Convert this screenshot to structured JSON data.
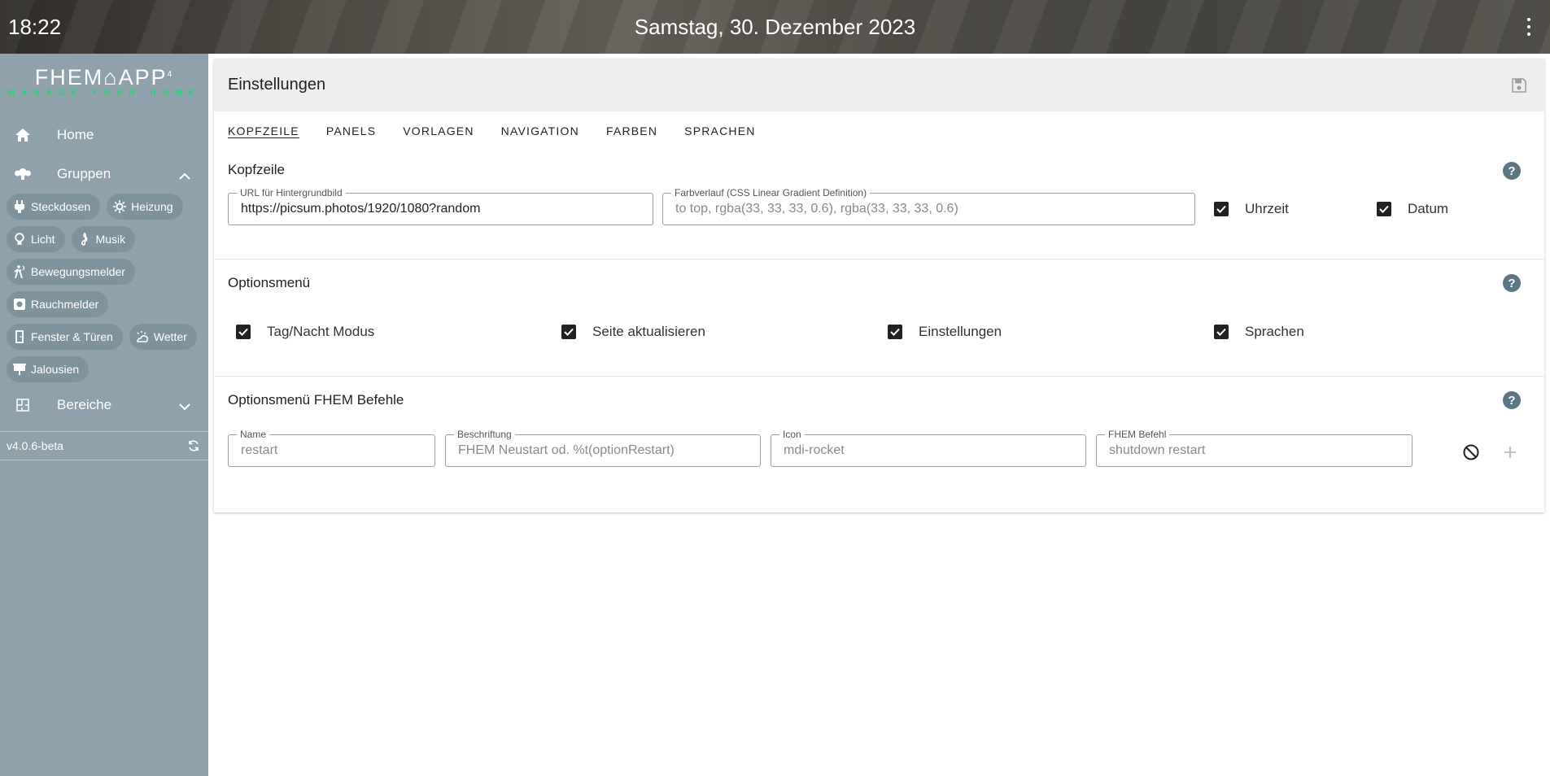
{
  "header": {
    "time": "18:22",
    "date": "Samstag, 30. Dezember 2023",
    "menu_icon": "dots-vertical-icon"
  },
  "sidebar": {
    "logo_main": "FHEM⌂APP",
    "logo_sup": "4",
    "logo_sub": "MANAGE YOUR HOME",
    "home": {
      "label": "Home",
      "icon": "home-icon"
    },
    "groups": {
      "label": "Gruppen",
      "icon": "lightbulb-group-icon",
      "expanded": true
    },
    "chips": [
      {
        "label": "Steckdosen",
        "icon": "power-plug-icon"
      },
      {
        "label": "Heizung",
        "icon": "radiator-icon"
      },
      {
        "label": "Licht",
        "icon": "lightbulb-icon"
      },
      {
        "label": "Musik",
        "icon": "music-clef-icon"
      },
      {
        "label": "Bewegungsmelder",
        "icon": "motion-sensor-icon"
      },
      {
        "label": "Rauchmelder",
        "icon": "smoke-detector-icon"
      },
      {
        "label": "Fenster & Türen",
        "icon": "door-icon"
      },
      {
        "label": "Wetter",
        "icon": "weather-icon"
      },
      {
        "label": "Jalousien",
        "icon": "blinds-icon"
      }
    ],
    "areas": {
      "label": "Bereiche",
      "icon": "floor-plan-icon",
      "expanded": false
    },
    "version": "v4.0.6-beta"
  },
  "settings": {
    "title": "Einstellungen",
    "tabs": [
      "KOPFZEILE",
      "PANELS",
      "VORLAGEN",
      "NAVIGATION",
      "FARBEN",
      "SPRACHEN"
    ],
    "active_tab": "KOPFZEILE",
    "kopfzeile": {
      "title": "Kopfzeile",
      "url_label": "URL für Hintergrundbild",
      "url_value": "https://picsum.photos/1920/1080?random",
      "gradient_label": "Farbverlauf (CSS Linear Gradient Definition)",
      "gradient_placeholder": "to top, rgba(33, 33, 33, 0.6), rgba(33, 33, 33, 0.6)",
      "time_label": "Uhrzeit",
      "time_checked": true,
      "date_label": "Datum",
      "date_checked": true
    },
    "optionsmenu": {
      "title": "Optionsmenü",
      "items": [
        {
          "label": "Tag/Nacht Modus",
          "checked": true
        },
        {
          "label": "Seite aktualisieren",
          "checked": true
        },
        {
          "label": "Einstellungen",
          "checked": true
        },
        {
          "label": "Sprachen",
          "checked": true
        }
      ]
    },
    "fhem_commands": {
      "title": "Optionsmenü FHEM Befehle",
      "name_label": "Name",
      "name_placeholder": "restart",
      "caption_label": "Beschriftung",
      "caption_placeholder": "FHEM Neustart od. %t(optionRestart)",
      "icon_label": "Icon",
      "icon_placeholder": "mdi-rocket",
      "cmd_label": "FHEM Befehl",
      "cmd_placeholder": "shutdown restart"
    }
  }
}
